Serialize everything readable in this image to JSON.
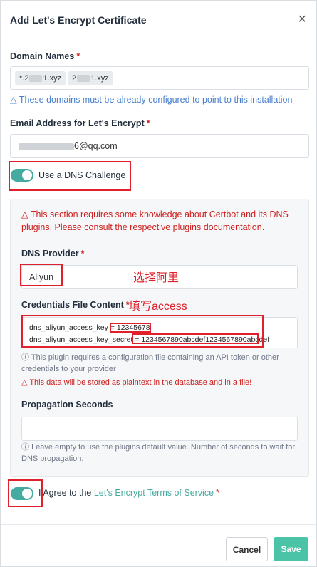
{
  "modal": {
    "title": "Add Let's Encrypt Certificate",
    "close_glyph": "×"
  },
  "domain_names": {
    "label": "Domain Names",
    "required_mark": "*",
    "chips": [
      {
        "prefix": "*.2",
        "suffix": "1.xyz"
      },
      {
        "prefix": "2",
        "suffix": "1.xyz"
      }
    ],
    "hint_icon": "△",
    "hint": "These domains must be already configured to point to this installation"
  },
  "email": {
    "label": "Email Address for Let's Encrypt",
    "required_mark": "*",
    "value_suffix": "6@qq.com"
  },
  "dns_challenge": {
    "label": "Use a DNS Challenge",
    "enabled": true
  },
  "dns_section": {
    "warning_icon": "△",
    "warning": "This section requires some knowledge about Certbot and its DNS plugins. Please consult the respective plugins documentation.",
    "provider_label": "DNS Provider",
    "provider_value": "Aliyun",
    "provider_annotation": "选择阿里",
    "credentials_label": "Credentials File Content",
    "credentials_annotation": "填写access",
    "credentials_line1_key": "dns_aliyun_access_key = ",
    "credentials_line1_value": "12345678",
    "credentials_line2_key": "dns_aliyun_access_key_secret = ",
    "credentials_line2_value": "1234567890abcdef1234567890abcdef",
    "info_icon": "ⓘ",
    "plugin_note": "This plugin requires a configuration file containing an API token or other credentials to your provider",
    "plaintext_warning": "This data will be stored as plaintext in the database and in a file!",
    "propagation_label": "Propagation Seconds",
    "propagation_value": "",
    "propagation_note": "Leave empty to use the plugins default value. Number of seconds to wait for DNS propagation."
  },
  "agree": {
    "prefix": "I Agree to the ",
    "link": "Let's Encrypt Terms of Service",
    "required_mark": "*",
    "enabled": true
  },
  "footer": {
    "cancel_label": "Cancel",
    "save_label": "Save"
  },
  "colors": {
    "accent": "#45aaa0",
    "save": "#4bc3a6",
    "danger": "#cd201f",
    "info": "#467fcf",
    "annotation": "#e0202a"
  }
}
